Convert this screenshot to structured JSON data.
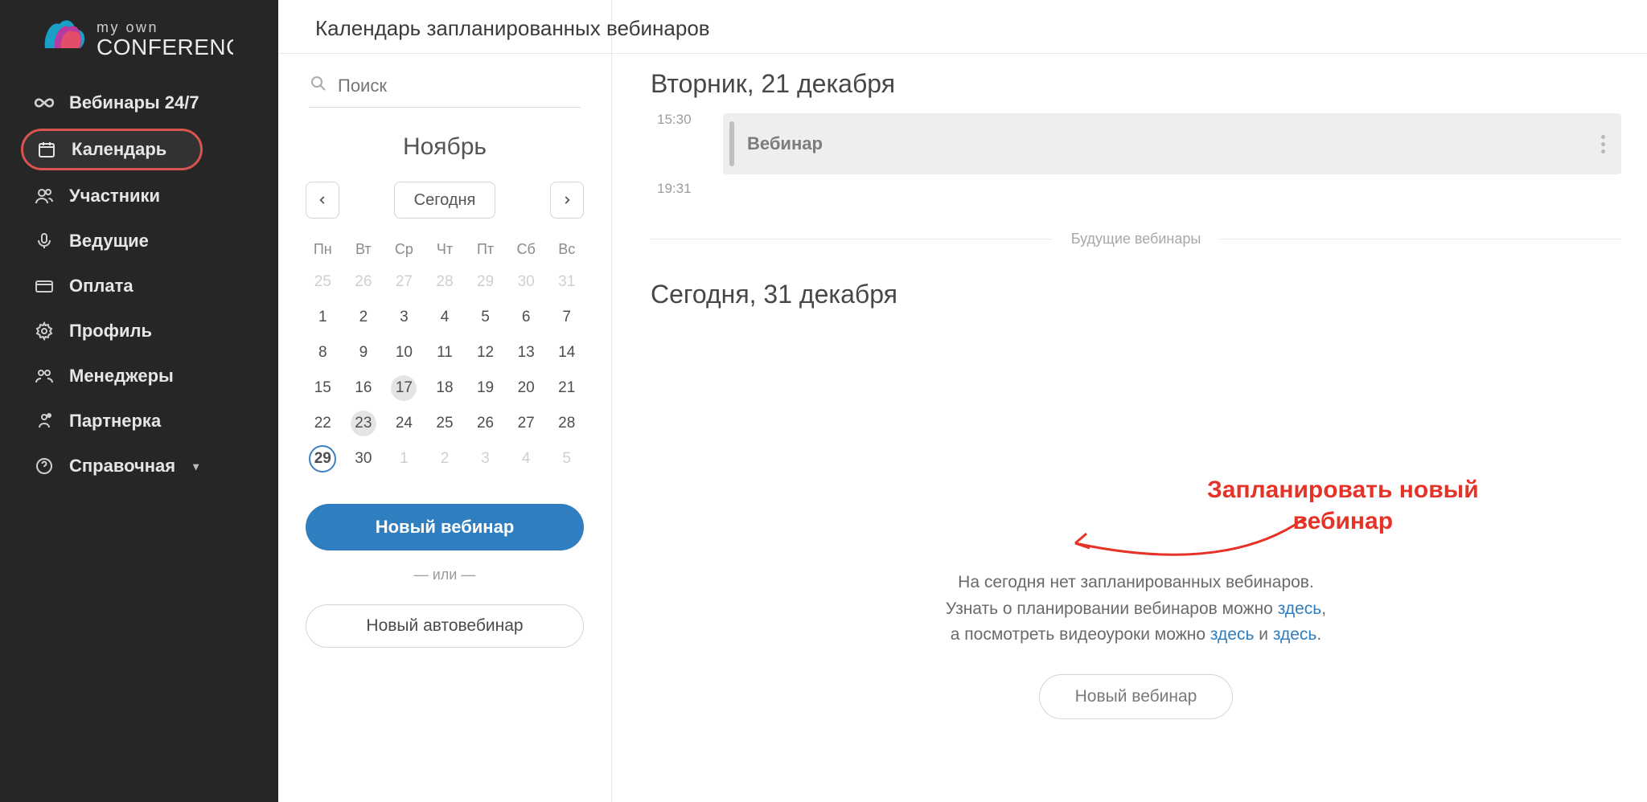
{
  "brand": {
    "line1": "my own",
    "line2": "CONFERENCE"
  },
  "sidebar": {
    "items": [
      {
        "label": "Вебинары 24/7",
        "icon": "infinity"
      },
      {
        "label": "Календарь",
        "icon": "calendar",
        "active": true
      },
      {
        "label": "Участники",
        "icon": "users"
      },
      {
        "label": "Ведущие",
        "icon": "mic"
      },
      {
        "label": "Оплата",
        "icon": "card"
      },
      {
        "label": "Профиль",
        "icon": "gear"
      },
      {
        "label": "Менеджеры",
        "icon": "managers"
      },
      {
        "label": "Партнерка",
        "icon": "partner"
      },
      {
        "label": "Справочная",
        "icon": "help",
        "has_caret": true
      }
    ]
  },
  "header": {
    "title": "Календарь запланированных вебинаров"
  },
  "search": {
    "placeholder": "Поиск"
  },
  "calendar": {
    "month_label": "Ноябрь",
    "today_label": "Сегодня",
    "weekdays": [
      "Пн",
      "Вт",
      "Ср",
      "Чт",
      "Пт",
      "Сб",
      "Вс"
    ],
    "weeks": [
      [
        {
          "n": "25",
          "other": true
        },
        {
          "n": "26",
          "other": true
        },
        {
          "n": "27",
          "other": true
        },
        {
          "n": "28",
          "other": true
        },
        {
          "n": "29",
          "other": true
        },
        {
          "n": "30",
          "other": true
        },
        {
          "n": "31",
          "other": true
        }
      ],
      [
        {
          "n": "1"
        },
        {
          "n": "2"
        },
        {
          "n": "3"
        },
        {
          "n": "4"
        },
        {
          "n": "5"
        },
        {
          "n": "6"
        },
        {
          "n": "7"
        }
      ],
      [
        {
          "n": "8"
        },
        {
          "n": "9"
        },
        {
          "n": "10"
        },
        {
          "n": "11"
        },
        {
          "n": "12"
        },
        {
          "n": "13"
        },
        {
          "n": "14"
        }
      ],
      [
        {
          "n": "15"
        },
        {
          "n": "16"
        },
        {
          "n": "17",
          "marked": true
        },
        {
          "n": "18"
        },
        {
          "n": "19"
        },
        {
          "n": "20"
        },
        {
          "n": "21"
        }
      ],
      [
        {
          "n": "22"
        },
        {
          "n": "23",
          "marked": true
        },
        {
          "n": "24"
        },
        {
          "n": "25"
        },
        {
          "n": "26"
        },
        {
          "n": "27"
        },
        {
          "n": "28"
        }
      ],
      [
        {
          "n": "29",
          "today": true
        },
        {
          "n": "30"
        },
        {
          "n": "1",
          "other": true
        },
        {
          "n": "2",
          "other": true
        },
        {
          "n": "3",
          "other": true
        },
        {
          "n": "4",
          "other": true
        },
        {
          "n": "5",
          "other": true
        }
      ]
    ],
    "new_webinar_label": "Новый вебинар",
    "or_label": "— или —",
    "new_auto_label": "Новый автовебинар"
  },
  "content": {
    "day1_heading": "Вторник, 21 декабря",
    "event": {
      "start": "15:30",
      "end": "19:31",
      "title": "Вебинар"
    },
    "future_label": "Будущие вебинары",
    "day2_heading": "Сегодня, 31 декабря",
    "annotation_line1": "Запланировать  новый",
    "annotation_line2": "вебинар",
    "empty_line1": "На сегодня нет запланированных вебинаров.",
    "empty_line2a": "Узнать о планировании вебинаров можно ",
    "empty_link1": "здесь",
    "empty_line2b": ",",
    "empty_line3a": "а посмотреть видеоуроки можно ",
    "empty_link2": "здесь",
    "empty_line3b": " и ",
    "empty_link3": "здесь",
    "empty_line3c": ".",
    "empty_btn": "Новый вебинар"
  }
}
